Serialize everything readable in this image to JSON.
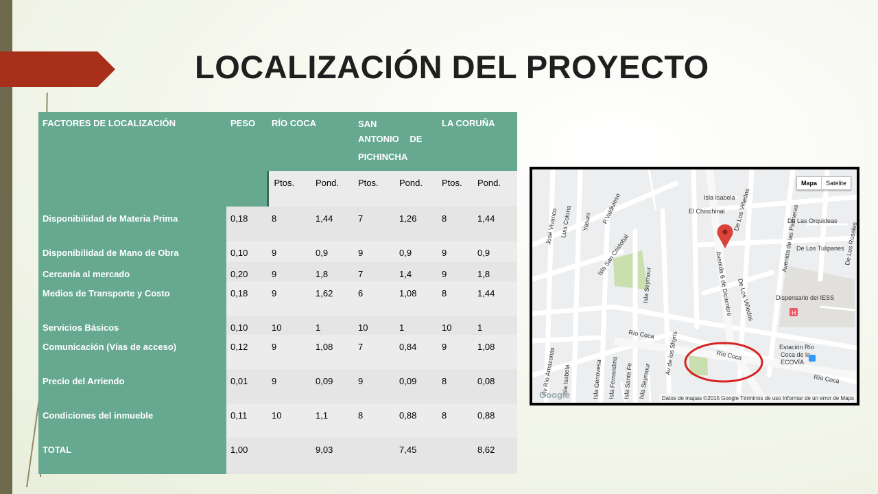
{
  "title": "LOCALIZACIÓN DEL PROYECTO",
  "table": {
    "headers": {
      "factor": "FACTORES DE LOCALIZACIÓN",
      "peso": "PESO",
      "loc1": "RÍO COCA",
      "loc2_line1": "SAN",
      "loc2_line2": "ANTONIO DE",
      "loc2_line3": "PICHINCHA",
      "loc3": "LA CORUÑA"
    },
    "sub": [
      "Ptos.",
      "Pond.",
      "Ptos.",
      "Pond.",
      "Ptos.",
      "Pond."
    ],
    "rows": [
      {
        "factor": "Disponibilidad de Materia Prima",
        "peso": "0,18",
        "p1": "8",
        "w1": "1,44",
        "p2": "7",
        "w2": "1,26",
        "p3": "8",
        "w3": "1,44"
      },
      {
        "factor": "Disponibilidad de Mano de Obra",
        "peso": "0,10",
        "p1": "9",
        "w1": "0,9",
        "p2": "9",
        "w2": "0,9",
        "p3": "9",
        "w3": "0,9"
      },
      {
        "factor": "Cercanía al mercado",
        "peso": "0,20",
        "p1": "9",
        "w1": "1,8",
        "p2": "7",
        "w2": "1,4",
        "p3": "9",
        "w3": "1,8"
      },
      {
        "factor": "Medios de Transporte y Costo",
        "peso": "0,18",
        "p1": "9",
        "w1": "1,62",
        "p2": "6",
        "w2": "1,08",
        "p3": "8",
        "w3": "1,44"
      },
      {
        "factor": "Servicios Básicos",
        "peso": "0,10",
        "p1": "10",
        "w1": "1",
        "p2": "10",
        "w2": "1",
        "p3": "10",
        "w3": "1"
      },
      {
        "factor": "Comunicación (Vías de acceso)",
        "peso": "0,12",
        "p1": "9",
        "w1": "1,08",
        "p2": "7",
        "w2": "0,84",
        "p3": "9",
        "w3": "1,08"
      },
      {
        "factor": "Precio del Arriendo",
        "peso": "0,01",
        "p1": "9",
        "w1": "0,09",
        "p2": "9",
        "w2": "0,09",
        "p3": "8",
        "w3": "0,08"
      },
      {
        "factor": "Condiciones del inmueble",
        "peso": "0,11",
        "p1": "10",
        "w1": "1,1",
        "p2": "8",
        "w2": "0,88",
        "p3": "8",
        "w3": "0,88"
      },
      {
        "factor": "TOTAL",
        "peso": "1,00",
        "p1": "",
        "w1": "9,03",
        "p2": "",
        "w2": "7,45",
        "p3": "",
        "w3": "8,62"
      }
    ]
  },
  "map": {
    "controls": {
      "map": "Mapa",
      "satellite": "Satélite"
    },
    "attribution": "Datos de mapas ©2015 Google    Términos de uso    Informar de un error de Maps",
    "logo": "Google",
    "labels": {
      "isla_isabela": "Isla Isabela",
      "los_vinedos": "De Los Viñedos",
      "el_chinchinal": "El Chinchinal",
      "pvaldivieso": "P.Valdivieso",
      "luis_colona": "Luis Colona",
      "yasuni": "Yasuni",
      "jose_vivanco": "José Vivanco",
      "isla_san_cristobal": "Isla San Cristobal",
      "isla_seymour": "Isla Seymour",
      "av_6_diciembre": "Avenida 6 de Diciembre",
      "av_palmeras": "Avenida de las Palmeras",
      "las_orquideas": "De Las Orquideas",
      "los_tulipanes": "De Los Tulipanes",
      "los_rosales": "De Los Rosales",
      "los_vinedos2": "De Los Viñedos",
      "dispensario": "Dispensario del IESS",
      "rio_coca": "Río Coca",
      "rio_coca2": "Río Coca",
      "rio_coca3": "Río Coca",
      "estacion": "Estación Río",
      "estacion2": "Coca de la",
      "ecovia": "ECOVÍA",
      "av_rio_amazonas": "Av Río Amazonas",
      "isla_isabela2": "Isla Isabela",
      "isla_genovesa": "Isla Genovesa",
      "isla_fernandina": "Isla Fernandina",
      "isla_santa_fe": "Isla Santa Fe",
      "isla_seymour2": "Isla Seymour",
      "av_shyris": "Av de los Shyris"
    }
  }
}
